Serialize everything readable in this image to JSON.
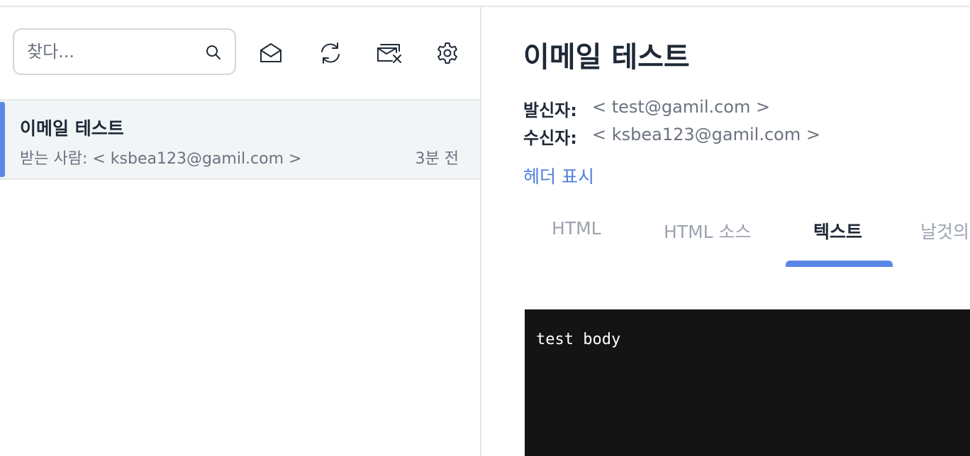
{
  "search": {
    "placeholder": "찾다..."
  },
  "toolbar": {
    "icons": [
      "search-icon",
      "envelope-open-icon",
      "refresh-icon",
      "mailbox-clear-icon",
      "gear-icon"
    ]
  },
  "mail_list": [
    {
      "subject": "이메일 테스트",
      "to": "받는 사람: < ksbea123@gamil.com >",
      "time": "3분 전",
      "selected": true
    }
  ],
  "message": {
    "title": "이메일 테스트",
    "from_label": "발신자:",
    "from_value": "< test@gamil.com >",
    "to_label": "수신자:",
    "to_value": "< ksbea123@gamil.com >",
    "show_headers": "헤더 표시",
    "tabs": [
      "HTML",
      "HTML 소스",
      "텍스트",
      "날것의"
    ],
    "active_tab": "텍스트",
    "body": "test body"
  },
  "colors": {
    "accent": "#5b87e6",
    "link": "#4f7ee0",
    "selected_row": "#f1f5f6",
    "body_bg": "#141414"
  }
}
